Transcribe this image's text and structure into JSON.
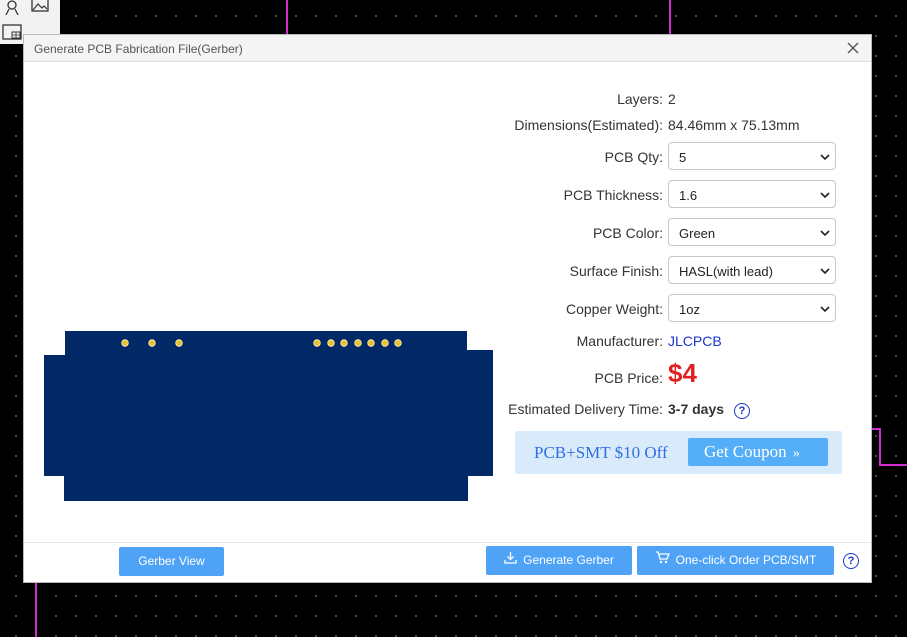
{
  "canvas": {
    "trace_color": "#d02ad0",
    "background_color": "#000000"
  },
  "toolstrip": {
    "icons": [
      "user-icon",
      "image-icon",
      "layout-icon"
    ]
  },
  "dialog": {
    "title": "Generate PCB Fabrication File(Gerber)",
    "close_icon": "close-icon",
    "preview": {
      "board_color": "#022966",
      "pad_color": "#e8c030"
    },
    "fields": {
      "layers_label": "Layers:",
      "layers_value": "2",
      "dimensions_label": "Dimensions(Estimated):",
      "dimensions_value": "84.46mm x 75.13mm",
      "qty_label": "PCB Qty:",
      "qty_value": "5",
      "thickness_label": "PCB Thickness:",
      "thickness_value": "1.6",
      "color_label": "PCB Color:",
      "color_value": "Green",
      "finish_label": "Surface Finish:",
      "finish_value": "HASL(with lead)",
      "copper_label": "Copper Weight:",
      "copper_value": "1oz",
      "manufacturer_label": "Manufacturer:",
      "manufacturer_value": "JLCPCB",
      "price_label": "PCB Price:",
      "price_value": "$4",
      "delivery_label": "Estimated Delivery Time:",
      "delivery_value": "3-7 days",
      "help_glyph": "?"
    },
    "coupon": {
      "text": "PCB+SMT $10 Off",
      "button_label": "Get Coupon",
      "button_chevron": "»"
    },
    "footer": {
      "gerber_view_label": "Gerber View",
      "generate_label": "Generate Gerber",
      "order_label": "One-click Order PCB/SMT",
      "help_glyph": "?"
    },
    "colors": {
      "accent": "#4fa3f7",
      "price": "#e02020",
      "link": "#1a35c8"
    }
  }
}
